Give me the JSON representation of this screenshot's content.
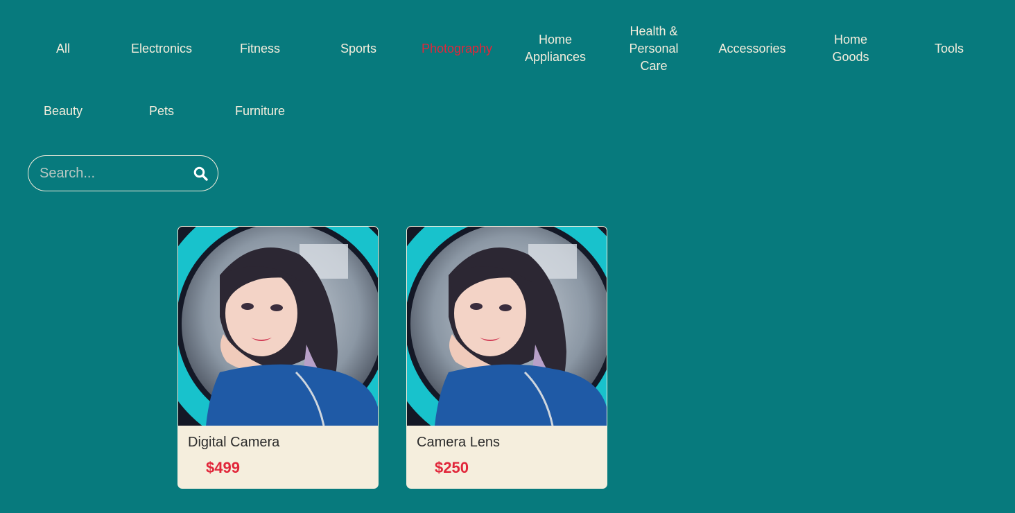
{
  "nav": {
    "active": "Photography",
    "categories": [
      {
        "lines": [
          "All"
        ]
      },
      {
        "lines": [
          "Electronics"
        ]
      },
      {
        "lines": [
          "Fitness"
        ]
      },
      {
        "lines": [
          "Sports"
        ]
      },
      {
        "lines": [
          "Photography"
        ]
      },
      {
        "lines": [
          "Home",
          "Appliances"
        ]
      },
      {
        "lines": [
          "Health &",
          "Personal",
          "Care"
        ]
      },
      {
        "lines": [
          "Accessories"
        ]
      },
      {
        "lines": [
          "Home",
          "Goods"
        ]
      },
      {
        "lines": [
          "Tools"
        ]
      },
      {
        "lines": [
          "Beauty"
        ]
      },
      {
        "lines": [
          "Pets"
        ]
      },
      {
        "lines": [
          "Furniture"
        ]
      }
    ]
  },
  "search": {
    "placeholder": "Search...",
    "value": "",
    "icon": "search-icon"
  },
  "products": [
    {
      "name": "Digital Camera",
      "price": "$499"
    },
    {
      "name": "Camera Lens",
      "price": "$250"
    }
  ],
  "colors": {
    "background": "#077a7d",
    "text": "#f5eedd",
    "active": "#e1263a",
    "card": "#f5eedd",
    "price": "#e1263a"
  }
}
